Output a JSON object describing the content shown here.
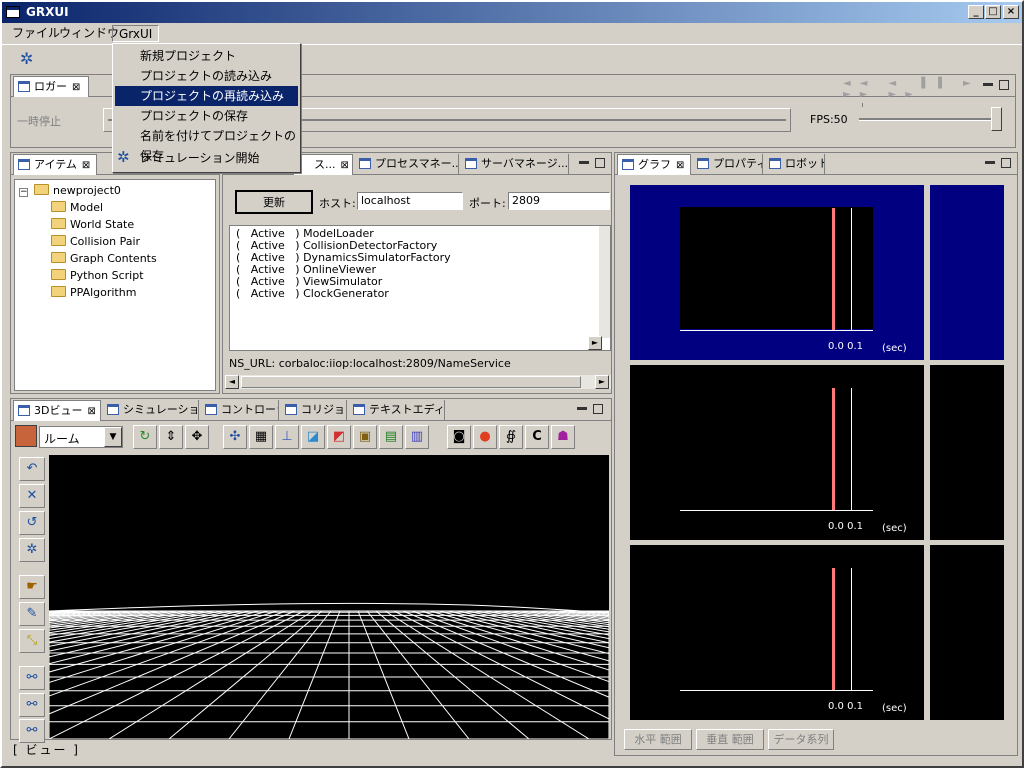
{
  "window": {
    "title": "GRXUI"
  },
  "menubar": {
    "items": [
      "ファイル",
      "ウィンドウ",
      "GrxUI"
    ]
  },
  "grxui_menu": {
    "items": [
      "新規プロジェクト",
      "プロジェクトの読み込み",
      "プロジェクトの再読み込み",
      "プロジェクトの保存",
      "名前を付けてプロジェクトの保存",
      "シミュレーション開始"
    ],
    "highlighted": 2
  },
  "logger": {
    "tab": "ロガー",
    "pause_label": "一時停止",
    "fps_label": "FPS:50"
  },
  "item_panel": {
    "tab": "アイテム",
    "root": "newproject0",
    "children": [
      "Model",
      "World State",
      "Collision Pair",
      "Graph Contents",
      "Python Script",
      "PPAlgorithm"
    ]
  },
  "server_panel": {
    "tabs": [
      "ス...",
      "プロセスマネー...",
      "サーバマネージ..."
    ],
    "refresh_label": "更新",
    "host_label": "ホスト:",
    "host_value": "localhost",
    "port_label": "ポート:",
    "port_value": "2809",
    "rows": [
      "(   Active   ) ModelLoader",
      "(   Active   ) CollisionDetectorFactory",
      "(   Active   ) DynamicsSimulatorFactory",
      "(   Active   ) OnlineViewer",
      "(   Active   ) ViewSimulator",
      "(   Active   ) ClockGenerator"
    ],
    "ns_url": "NS_URL: corbaloc:iiop:localhost:2809/NameService"
  },
  "graph_panel": {
    "tabs": [
      "グラフ",
      "プロパティ",
      "ロボット"
    ],
    "x_value": "0.0 0.1",
    "x_unit": "(sec)",
    "buttons": [
      "水平 範囲",
      "垂直 範囲",
      "データ系列"
    ]
  },
  "view_panel": {
    "tabs": [
      "3Dビュー",
      "シミュレーション",
      "コントローラ",
      "コリジョン",
      "テキストエディタ"
    ],
    "mode_select": "ルーム",
    "status": "[ ビュー ]"
  },
  "colors": {
    "accent": "#0a246a",
    "graph_selected_bg": "#000080",
    "marker": "#ff7a7a"
  }
}
